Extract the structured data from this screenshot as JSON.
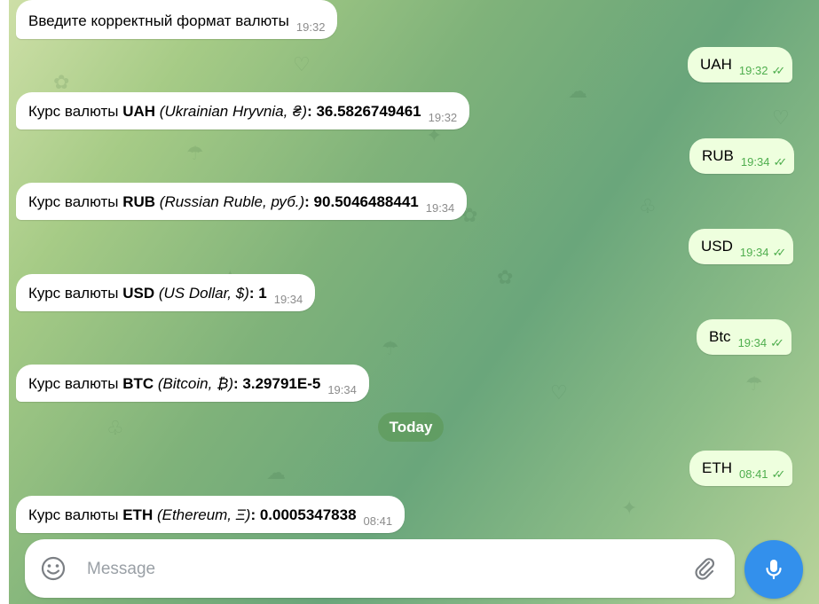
{
  "messages": [
    {
      "dir": "in",
      "text": "Введите корректный формат валюты",
      "time": "19:32"
    },
    {
      "dir": "out",
      "text": "UAH",
      "time": "19:32"
    },
    {
      "dir": "in",
      "prefix": "Курс валюты ",
      "code": "UAH",
      "name": " (Ukrainian Hryvnia, ₴)",
      "value": ": 36.5826749461",
      "time": "19:32"
    },
    {
      "dir": "out",
      "text": "RUB",
      "time": "19:34"
    },
    {
      "dir": "in",
      "prefix": "Курс валюты ",
      "code": "RUB",
      "name": " (Russian Ruble, руб.)",
      "value": ": 90.5046488441",
      "time": "19:34"
    },
    {
      "dir": "out",
      "text": "USD",
      "time": "19:34"
    },
    {
      "dir": "in",
      "prefix": "Курс валюты ",
      "code": "USD",
      "name": " (US Dollar, $)",
      "value": ": 1",
      "time": "19:34"
    },
    {
      "dir": "out",
      "text": "Btc",
      "time": "19:34"
    },
    {
      "dir": "in",
      "prefix": "Курс валюты ",
      "code": "BTC",
      "name": " (Bitcoin, ₿)",
      "value": ": 3.29791E-5",
      "time": "19:34"
    },
    {
      "dir": "out",
      "text": "ETH",
      "time": "08:41"
    },
    {
      "dir": "in",
      "prefix": "Курс валюты ",
      "code": "ETH",
      "name": " (Ethereum, Ξ)",
      "value": ": 0.0005347838",
      "time": "08:41"
    }
  ],
  "date_divider": "Today",
  "composer": {
    "placeholder": "Message",
    "emoji_icon": "smile-icon",
    "attach_icon": "paperclip-icon",
    "mic_icon": "microphone-icon"
  },
  "colors": {
    "incoming_bubble": "#ffffff",
    "outgoing_bubble": "#eeffde",
    "read_check": "#4fae4e",
    "accent": "#3390ec"
  }
}
